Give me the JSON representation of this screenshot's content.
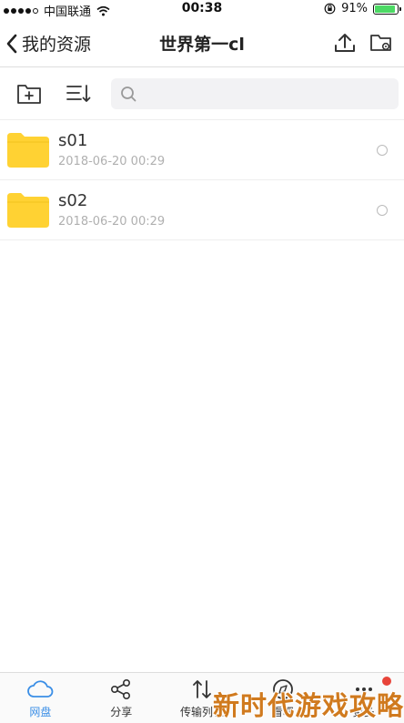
{
  "status_bar": {
    "carrier": "中国联通",
    "time": "00:38",
    "battery": "91%",
    "battery_level": 0.91
  },
  "nav": {
    "back_label": "我的资源",
    "title": "世界第一cl"
  },
  "toolbar": {
    "search_placeholder": ""
  },
  "files": [
    {
      "name": "s01",
      "date": "2018-06-20 00:29"
    },
    {
      "name": "s02",
      "date": "2018-06-20 00:29"
    }
  ],
  "tabs": [
    {
      "label": "网盘",
      "icon": "cloud-icon",
      "active": true
    },
    {
      "label": "分享",
      "icon": "share-icon",
      "active": false
    },
    {
      "label": "传输列表",
      "icon": "transfer-icon",
      "active": false
    },
    {
      "label": "看吧",
      "icon": "compass-icon",
      "active": false
    },
    {
      "label": "更多",
      "icon": "more-icon",
      "active": false,
      "badge": true
    }
  ],
  "watermark": "新时代游戏攻略",
  "colors": {
    "accent": "#3a8ee6",
    "folder": "#ffd233",
    "badge": "#e8443a",
    "watermark": "#d07a1e"
  }
}
